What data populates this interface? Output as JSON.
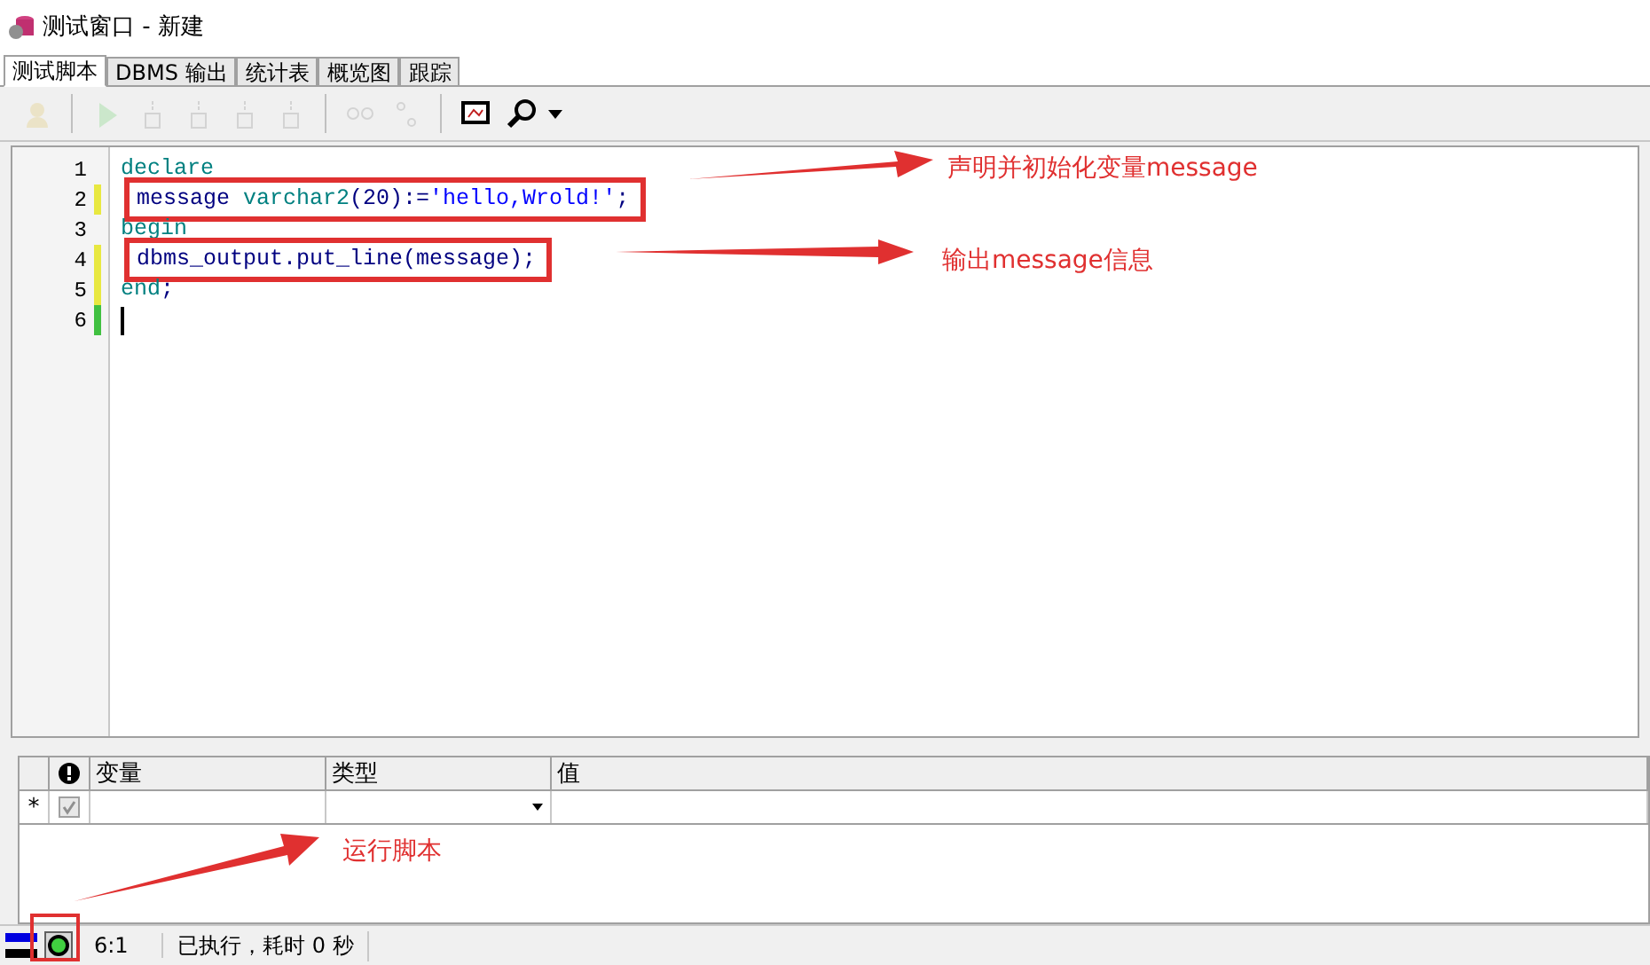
{
  "window": {
    "title": "测试窗口 - 新建"
  },
  "tabs": [
    {
      "label": "测试脚本",
      "selected": true
    },
    {
      "label": "DBMS 输出",
      "selected": false
    },
    {
      "label": "统计表",
      "selected": false
    },
    {
      "label": "概览图",
      "selected": false
    },
    {
      "label": "跟踪",
      "selected": false
    }
  ],
  "toolbar": [
    {
      "kind": "debug",
      "disabled": true
    },
    {
      "kind": "run",
      "disabled": true
    },
    {
      "kind": "step-into",
      "disabled": true
    },
    {
      "kind": "step-over",
      "disabled": true
    },
    {
      "kind": "step-out",
      "disabled": true
    },
    {
      "kind": "run-to-exception",
      "disabled": true
    },
    {
      "kind": "watch",
      "disabled": true
    },
    {
      "kind": "breakpoints",
      "disabled": true
    },
    {
      "kind": "output",
      "disabled": false
    },
    {
      "kind": "search",
      "disabled": false
    }
  ],
  "editor": {
    "lines": [
      {
        "number": "1",
        "modified": false,
        "saved": false,
        "highlighted": false,
        "indent": false,
        "tokens": [
          {
            "kind": "keyword",
            "text": "declare"
          }
        ]
      },
      {
        "number": "2",
        "modified": true,
        "saved": false,
        "highlighted": true,
        "indent": true,
        "tokens": [
          {
            "kind": "ident",
            "text": "message "
          },
          {
            "kind": "keyword",
            "text": "varchar2"
          },
          {
            "kind": "symbol",
            "text": "(20):="
          },
          {
            "kind": "string",
            "text": "'hello,Wrold!'"
          },
          {
            "kind": "symbol",
            "text": ";"
          }
        ]
      },
      {
        "number": "3",
        "modified": false,
        "saved": false,
        "highlighted": false,
        "indent": false,
        "tokens": [
          {
            "kind": "keyword",
            "text": "begin"
          }
        ]
      },
      {
        "number": "4",
        "modified": true,
        "saved": false,
        "highlighted": true,
        "indent": true,
        "tokens": [
          {
            "kind": "ident",
            "text": "dbms_output.put_line(message);"
          }
        ]
      },
      {
        "number": "5",
        "modified": true,
        "saved": false,
        "highlighted": false,
        "indent": false,
        "tokens": [
          {
            "kind": "keyword",
            "text": "end"
          },
          {
            "kind": "symbol",
            "text": ";"
          }
        ]
      },
      {
        "number": "6",
        "modified": false,
        "saved": true,
        "cursor": true
      }
    ]
  },
  "variables": {
    "columns": [
      "变量",
      "类型",
      "值"
    ],
    "rows": [
      {
        "marker": "*",
        "checked": true
      }
    ]
  },
  "status_bar": {
    "position": "6:1",
    "message": "已执行，耗时 0 秒"
  },
  "annotations": [
    {
      "kind": "arrow-label",
      "text": "声明并初始化变量message"
    },
    {
      "kind": "arrow-label",
      "text": "输出message信息"
    },
    {
      "kind": "arrow-label",
      "text": "运行脚本"
    }
  ]
}
